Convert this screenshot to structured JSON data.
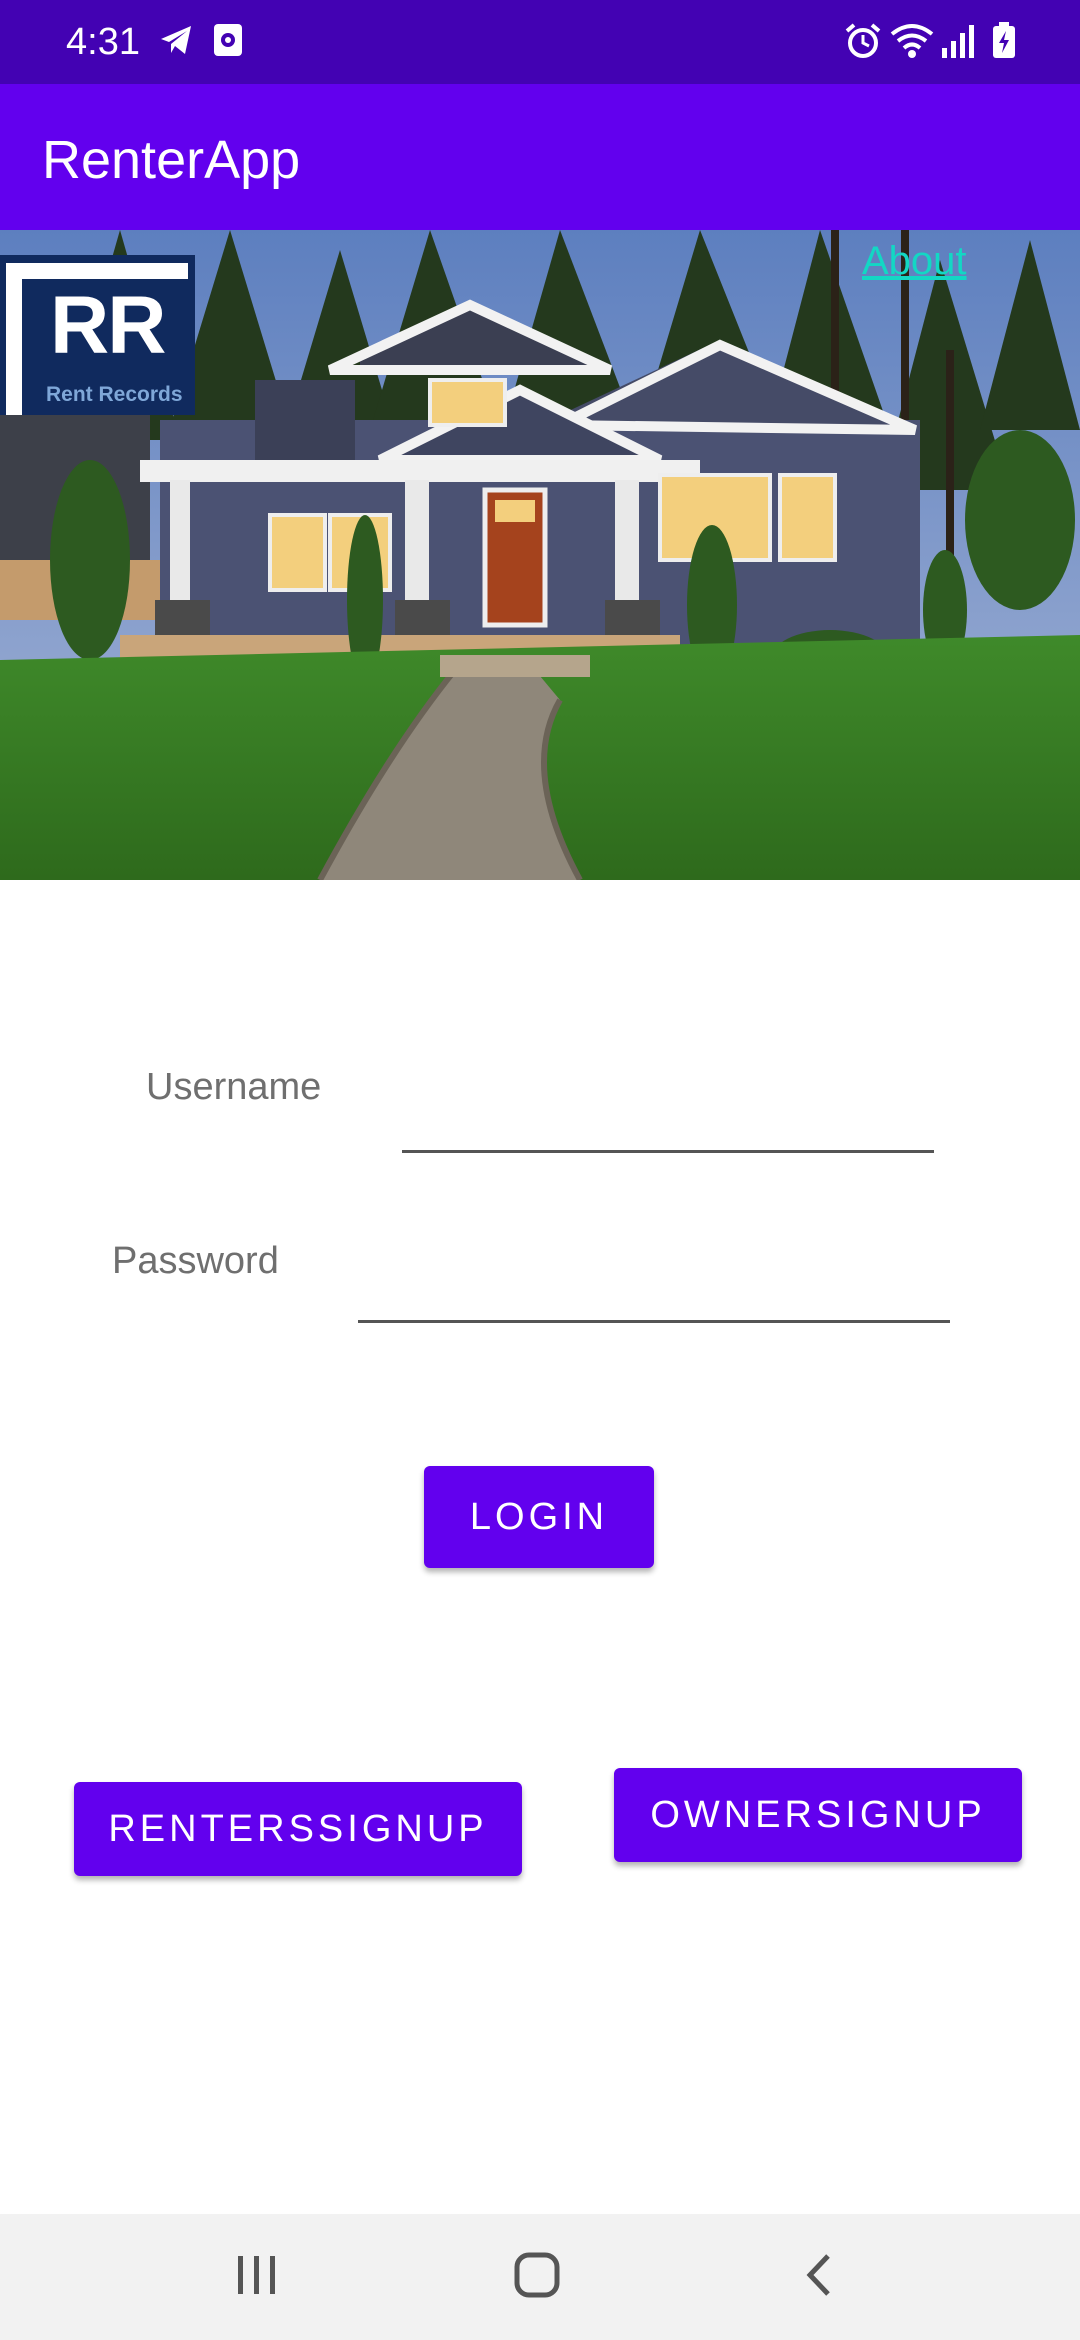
{
  "status_bar": {
    "time": "4:31",
    "icons": [
      "telegram-icon",
      "screen-record-icon",
      "alarm-icon",
      "wifi-icon",
      "signal-icon",
      "battery-icon"
    ]
  },
  "app_bar": {
    "title": "RenterApp"
  },
  "hero": {
    "logo": {
      "letters": "RR",
      "subtitle": "Rent Records"
    },
    "about_link": "About"
  },
  "form": {
    "username_label": "Username",
    "username_value": "",
    "password_label": "Password",
    "password_value": "",
    "login_button": "LOGIN"
  },
  "signup": {
    "renter_button": "RENTERSSIGNUP",
    "owner_button": "OWNERSIGNUP"
  },
  "nav_bar": {
    "icons": [
      "recent-apps-icon",
      "home-icon",
      "back-icon"
    ]
  },
  "colors": {
    "status_bar": "#4302b3",
    "primary": "#6200ee",
    "link": "#13d7c4",
    "logo_background": "#102a5e"
  }
}
